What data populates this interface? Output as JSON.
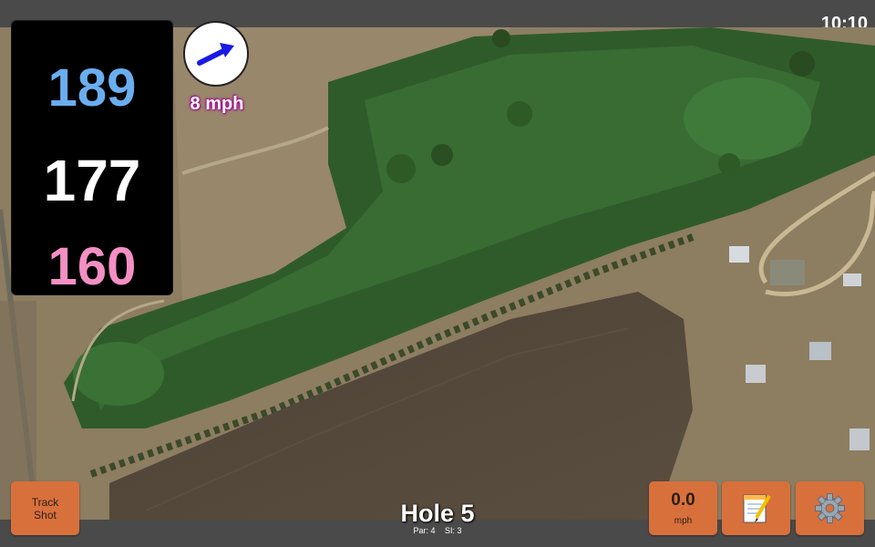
{
  "status_bar": {
    "time": "10:10"
  },
  "distances": {
    "back": "189",
    "middle": "177",
    "front": "160"
  },
  "wind": {
    "speed": "8 mph",
    "icon": "wind-direction-arrow-icon",
    "arrow_color": "#1a1ae6"
  },
  "buttons": {
    "track_shot": {
      "line1": "Track",
      "line2": "Shot"
    },
    "speed": {
      "value": "0.0",
      "unit": "mph"
    },
    "notes": {
      "icon": "notepad-icon"
    },
    "settings": {
      "icon": "gear-icon"
    }
  },
  "hole": {
    "title": "Hole 5",
    "par": "Par: 4",
    "si": "SI: 3"
  },
  "colors": {
    "button": "#d8703c",
    "back_distance": "#6aaef0",
    "middle_distance": "#ffffff",
    "front_distance": "#f48fc4",
    "wind_text_outline": "#a0148c"
  }
}
